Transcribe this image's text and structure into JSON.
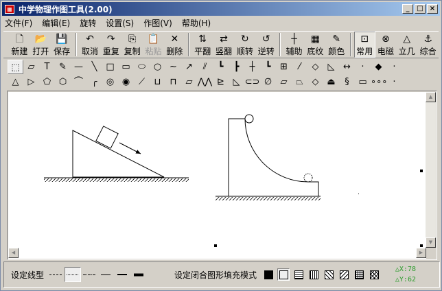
{
  "title": "中学物理作图工具(2.00)",
  "window_buttons": [
    "_",
    "□",
    "×"
  ],
  "menu": [
    "文件(F)",
    "编辑(E)",
    "旋转",
    "设置(S)",
    "作图(V)",
    "帮助(H)"
  ],
  "toolbar": [
    {
      "icon": "🗋",
      "label": "新建",
      "name": "new"
    },
    {
      "icon": "📂",
      "label": "打开",
      "name": "open"
    },
    {
      "icon": "💾",
      "label": "保存",
      "name": "save"
    },
    {
      "sep": true
    },
    {
      "icon": "↶",
      "label": "取消",
      "name": "undo"
    },
    {
      "icon": "↷",
      "label": "重复",
      "name": "redo"
    },
    {
      "icon": "⎘",
      "label": "复制",
      "name": "copy"
    },
    {
      "icon": "📋",
      "label": "粘贴",
      "name": "paste",
      "disabled": true
    },
    {
      "icon": "✕",
      "label": "删除",
      "name": "delete"
    },
    {
      "sep": true
    },
    {
      "icon": "⇅",
      "label": "平翻",
      "name": "flip-horizontal"
    },
    {
      "icon": "⇄",
      "label": "竖翻",
      "name": "flip-vertical"
    },
    {
      "icon": "↻",
      "label": "顺转",
      "name": "rotate-cw"
    },
    {
      "icon": "↺",
      "label": "逆转",
      "name": "rotate-ccw"
    },
    {
      "sep": true
    },
    {
      "icon": "┼",
      "label": "辅助",
      "name": "guides"
    },
    {
      "icon": "▦",
      "label": "底纹",
      "name": "grid"
    },
    {
      "icon": "✎",
      "label": "颜色",
      "name": "color"
    },
    {
      "sep": true
    },
    {
      "icon": "⊡",
      "label": "常用",
      "name": "common",
      "active": true
    },
    {
      "icon": "⊗",
      "label": "电磁",
      "name": "electromagnetic"
    },
    {
      "icon": "△",
      "label": "立几",
      "name": "solid-geometry"
    },
    {
      "icon": "⚓",
      "label": "综合",
      "name": "general"
    }
  ],
  "tools_row1": [
    "⬚",
    "▱",
    "T",
    "✎",
    "—",
    "╲",
    "□",
    "▭",
    "⬭",
    "○",
    "∼",
    "↗",
    "⫽",
    "┗",
    "┣",
    "┼",
    "┗",
    "⊞",
    "⁄",
    "◇",
    "◺",
    "↔",
    "·",
    "◆",
    "·"
  ],
  "tools_row2": [
    "△",
    "▷",
    "⬠",
    "⬡",
    "⌒",
    "╭",
    "◎",
    "◉",
    "⟋",
    "⊔",
    "⊓",
    "⏥",
    "⋀⋀",
    "⊵",
    "◺",
    "⊂⊃",
    "∅",
    "▱",
    "⏢",
    "◇",
    "⏏",
    "§",
    "▭",
    "∘∘∘",
    "·"
  ],
  "bottom": {
    "line_label": "设定线型",
    "line_types": [
      "- - -",
      "......",
      "-·-·",
      "—",
      "▬",
      "■"
    ],
    "fill_label": "设定闭合图形填充模式",
    "fills": [
      "solid",
      "none",
      "horizontal",
      "vertical",
      "diag-back",
      "diag-fwd",
      "cross",
      "diag-cross"
    ],
    "dx": "△X:78",
    "dy": "△Y:62"
  }
}
